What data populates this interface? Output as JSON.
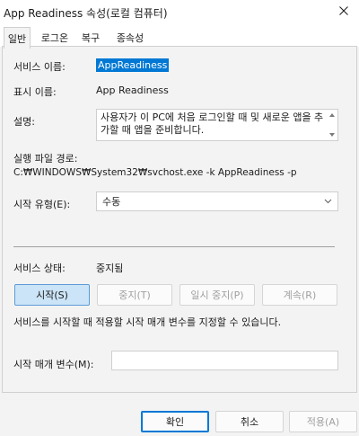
{
  "window": {
    "title": "App Readiness 속성(로컬 컴퓨터)"
  },
  "tabs": [
    {
      "label": "일반"
    },
    {
      "label": "로그온"
    },
    {
      "label": "복구"
    },
    {
      "label": "종속성"
    }
  ],
  "general": {
    "service_name_label": "서비스 이름:",
    "service_name": "AppReadiness",
    "display_name_label": "표시 이름:",
    "display_name": "App Readiness",
    "description_label": "설명:",
    "description": "사용자가 이 PC에 처음 로그인할 때 및 새로운 앱을 추가할 때 앱을 준비합니다.",
    "exe_path_label": "실행 파일 경로:",
    "exe_path": "C:₩WINDOWS₩System32₩svchost.exe -k AppReadiness -p",
    "startup_type_label": "시작 유형(E):",
    "startup_type": "수동",
    "status_label": "서비스 상태:",
    "status": "중지됨",
    "buttons": {
      "start": "시작(S)",
      "stop": "중지(T)",
      "pause": "일시 중지(P)",
      "resume": "계속(R)"
    },
    "hint": "서비스를 시작할 때 적용할 시작 매개 변수를 지정할 수 있습니다.",
    "params_label": "시작 매개 변수(M):",
    "params_value": ""
  },
  "footer": {
    "ok": "확인",
    "cancel": "취소",
    "apply": "적용(A)"
  }
}
